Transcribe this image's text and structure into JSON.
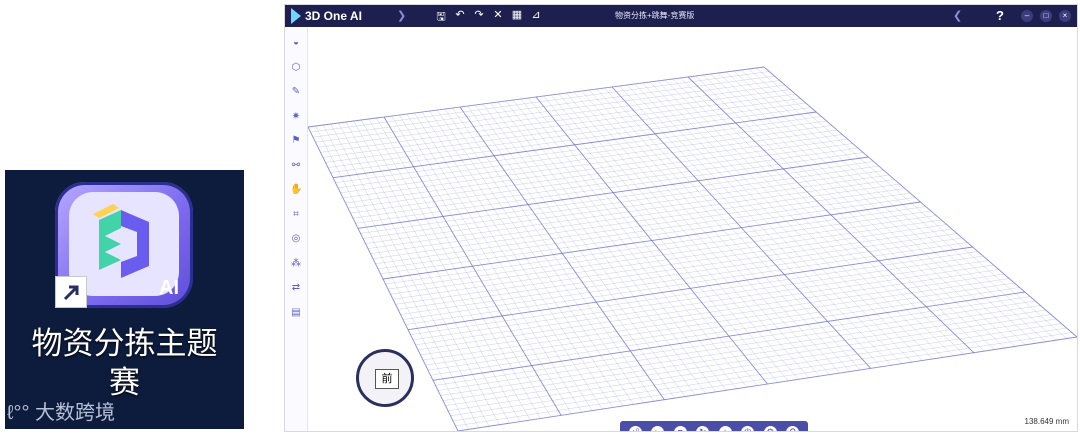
{
  "desktop": {
    "label_line1": "物资分拣主题",
    "label_line2": "赛",
    "ai_badge": "AI",
    "watermark": "大数跨境"
  },
  "window": {
    "app_name": "3D One AI",
    "doc_title": "物资分拣+跳舞-竞赛版",
    "help": "?",
    "quick_access": [
      {
        "icon": "save-icon",
        "glyph": "🖫"
      },
      {
        "icon": "undo-icon",
        "glyph": "↶"
      },
      {
        "icon": "redo-icon",
        "glyph": "↷"
      },
      {
        "icon": "delete-icon",
        "glyph": "✕"
      },
      {
        "icon": "grid-icon",
        "glyph": "▦"
      },
      {
        "icon": "measure-icon",
        "glyph": "⊿"
      }
    ],
    "window_controls": [
      "–",
      "□",
      "×"
    ]
  },
  "sidebar": [
    {
      "icon": "shape-icon",
      "glyph": "◒"
    },
    {
      "icon": "cube-icon",
      "glyph": "⬡"
    },
    {
      "icon": "sketch-icon",
      "glyph": "✎"
    },
    {
      "icon": "gear-component-icon",
      "glyph": "✷"
    },
    {
      "icon": "flag-icon",
      "glyph": "⚑"
    },
    {
      "icon": "link-icon",
      "glyph": "⚯"
    },
    {
      "icon": "hand-icon",
      "glyph": "✋"
    },
    {
      "icon": "frame-icon",
      "glyph": "⌗"
    },
    {
      "icon": "target-icon",
      "glyph": "◎"
    },
    {
      "icon": "network-icon",
      "glyph": "⁂"
    },
    {
      "icon": "swap-icon",
      "glyph": "⇄"
    },
    {
      "icon": "document-icon",
      "glyph": "▤"
    }
  ],
  "viewcube": {
    "front": "前"
  },
  "bottom_tools": [
    {
      "icon": "enter-icon",
      "glyph": "⏎"
    },
    {
      "icon": "play-icon",
      "glyph": "▸"
    },
    {
      "icon": "stop-icon",
      "glyph": "■"
    },
    {
      "icon": "rotate-icon",
      "glyph": "↻"
    },
    {
      "icon": "record-icon",
      "glyph": "●"
    },
    {
      "icon": "power-icon",
      "glyph": "⏻"
    },
    {
      "icon": "settings-icon",
      "glyph": "⚙"
    },
    {
      "icon": "search-settings-icon",
      "glyph": "⚲"
    }
  ],
  "status": {
    "scale": "138.649 mm"
  },
  "colors": {
    "titlebar": "#1d1f4f",
    "accent": "#4a4ea6",
    "grid": "#6b6fd1"
  }
}
